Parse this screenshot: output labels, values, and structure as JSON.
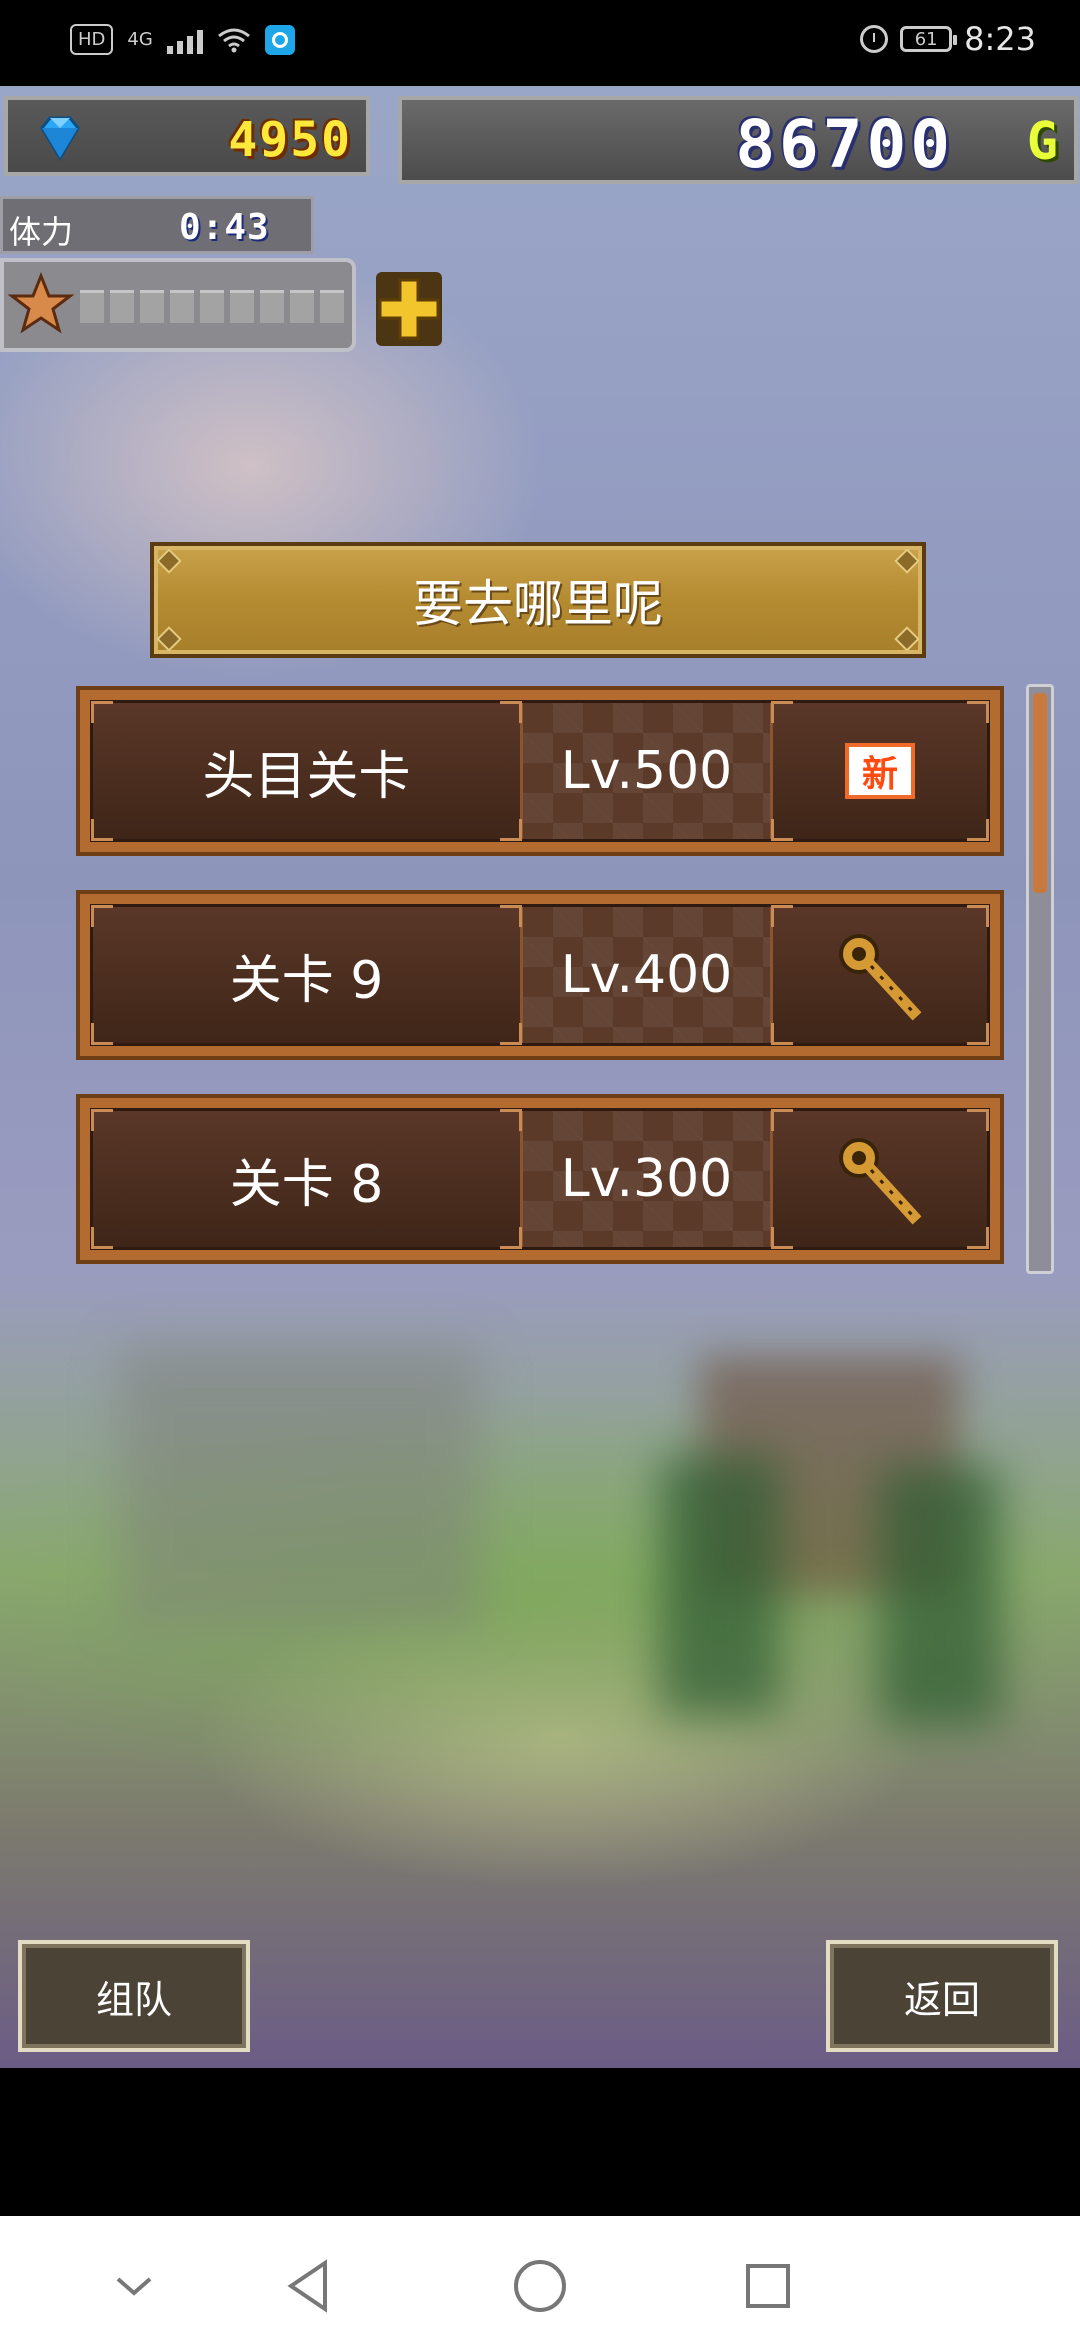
{
  "status_bar": {
    "hd_label": "HD",
    "network_label": "4G",
    "battery_level": "61",
    "time": "8:23"
  },
  "hud": {
    "gems": "4950",
    "gold": "86700",
    "gold_unit": "G",
    "stamina_label": "体力",
    "stamina_timer": "0:43"
  },
  "title": "要去哪里呢",
  "stages": [
    {
      "name": "头目关卡",
      "level": "Lv.500",
      "icon": "new-badge",
      "badge_text": "新"
    },
    {
      "name": "关卡 9",
      "level": "Lv.400",
      "icon": "key-icon"
    },
    {
      "name": "关卡 8",
      "level": "Lv.300",
      "icon": "key-icon"
    }
  ],
  "buttons": {
    "team": "组队",
    "back": "返回"
  },
  "colors": {
    "gem_text": "#ffe83c",
    "gold_unit": "#e9ff39",
    "row_border": "#b36b2f",
    "badge_new": "#f06a2a"
  }
}
